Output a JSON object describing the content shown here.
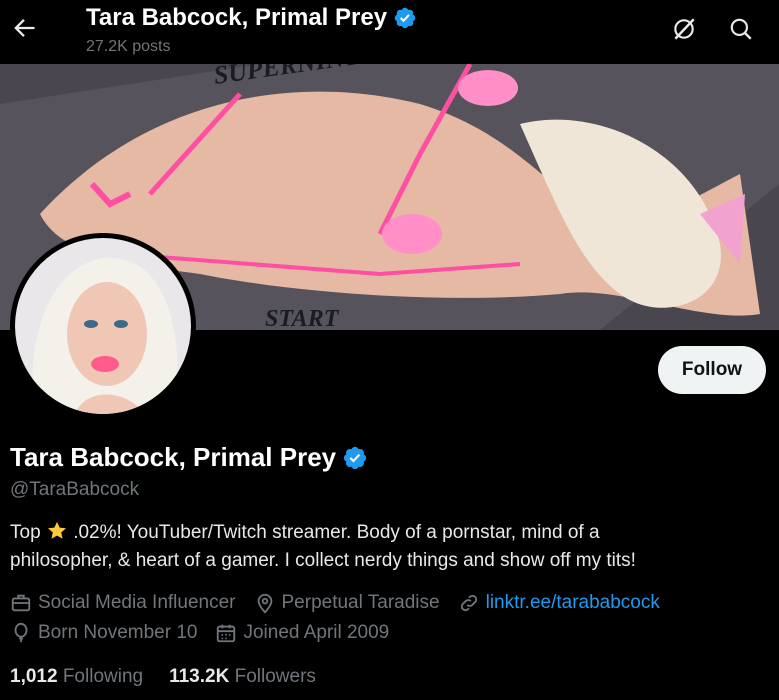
{
  "header": {
    "title": "Tara Babcock, Primal Prey",
    "posts": "27.2K posts"
  },
  "profile": {
    "name": "Tara Babcock, Primal Prey",
    "handle": "@TaraBabcock",
    "follow_label": "Follow",
    "bio_prefix": "Top ",
    "bio_rest_line1": " .02%! YouTuber/Twitch streamer. Body of a pornstar, mind of a",
    "bio_line2": "philosopher, & heart of a gamer. I collect nerdy things and show off my tits!",
    "category": "Social Media Influencer",
    "location": "Perpetual Taradise",
    "website": "linktr.ee/tarababcock",
    "birthday": "Born November 10",
    "joined": "Joined April 2009",
    "following_count": "1,012",
    "following_label": "Following",
    "followers_count": "113.2K",
    "followers_label": "Followers"
  },
  "icons": [
    "back-arrow-icon",
    "verified-badge-icon",
    "grok-icon",
    "search-icon",
    "briefcase-icon",
    "location-pin-icon",
    "link-icon",
    "balloon-icon",
    "calendar-icon",
    "star-emoji-icon"
  ],
  "colors": {
    "accent": "#1d9bf0",
    "muted": "#71767b",
    "text": "#e7e9ea",
    "button_bg": "#eff3f4"
  }
}
